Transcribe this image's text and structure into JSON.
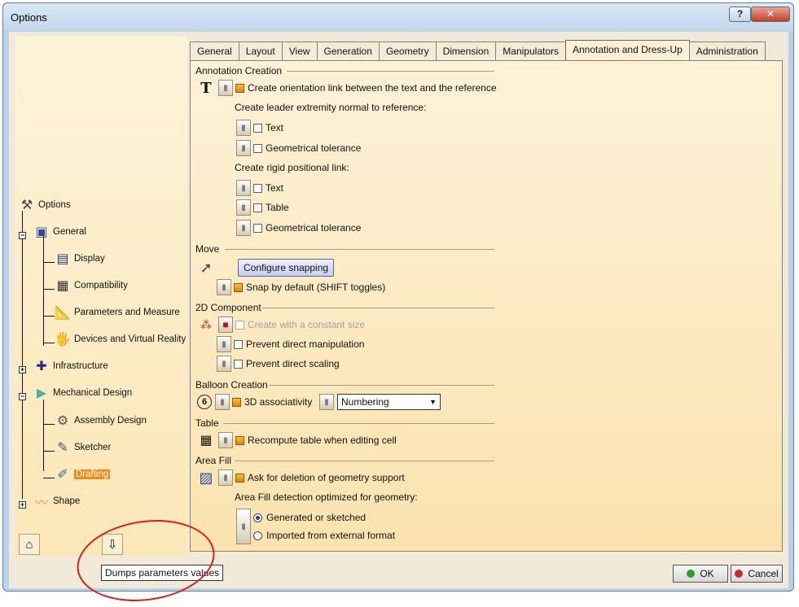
{
  "window": {
    "title": "Options",
    "help_label": "?",
    "close_label": "✕"
  },
  "tree": {
    "root": "Options",
    "items": [
      {
        "label": "General"
      },
      {
        "label": "Display"
      },
      {
        "label": "Compatibility"
      },
      {
        "label": "Parameters and Measure"
      },
      {
        "label": "Devices and Virtual Reality"
      },
      {
        "label": "Infrastructure"
      },
      {
        "label": "Mechanical Design"
      },
      {
        "label": "Assembly Design"
      },
      {
        "label": "Sketcher"
      },
      {
        "label": "Drafting",
        "selected": true
      },
      {
        "label": "Shape"
      }
    ],
    "expander_minus": "−",
    "expander_plus": "+"
  },
  "tooltip": {
    "text": "Dumps parameters values"
  },
  "tabs": [
    {
      "label": "General"
    },
    {
      "label": "Layout"
    },
    {
      "label": "View"
    },
    {
      "label": "Generation"
    },
    {
      "label": "Geometry"
    },
    {
      "label": "Dimension"
    },
    {
      "label": "Manipulators"
    },
    {
      "label": "Annotation and Dress-Up",
      "active": true
    },
    {
      "label": "Administration"
    }
  ],
  "annotation_creation": {
    "title": "Annotation Creation",
    "orientation_link": "Create orientation link between the text and the reference",
    "leader_label": "Create leader extremity normal to reference:",
    "leader_text": "Text",
    "leader_geo_tol": "Geometrical tolerance",
    "rigid_label": "Create rigid positional link:",
    "rigid_text": "Text",
    "rigid_table": "Table",
    "rigid_geo_tol": "Geometrical tolerance"
  },
  "move": {
    "title": "Move",
    "configure_snapping": "Configure snapping",
    "snap_default": "Snap by default (SHIFT toggles)"
  },
  "component_2d": {
    "title": "2D Component",
    "constant_size": "Create with a constant size",
    "prevent_manipulation": "Prevent direct manipulation",
    "prevent_scaling": "Prevent direct scaling"
  },
  "balloon": {
    "title": "Balloon Creation",
    "icon_text": "6",
    "associativity": "3D associativity",
    "select_value": "Numbering"
  },
  "table": {
    "title": "Table",
    "recompute": "Recompute table when editing cell"
  },
  "area_fill": {
    "title": "Area Fill",
    "ask_deletion": "Ask for deletion of geometry support",
    "detection_label": "Area Fill detection optimized for geometry:",
    "option_generated": "Generated or sketched",
    "option_imported": "Imported from external format"
  },
  "footer": {
    "ok": "OK",
    "cancel": "Cancel"
  },
  "colors": {
    "accent_selected": "#f08a14",
    "annotation_circle": "#d3201e"
  }
}
